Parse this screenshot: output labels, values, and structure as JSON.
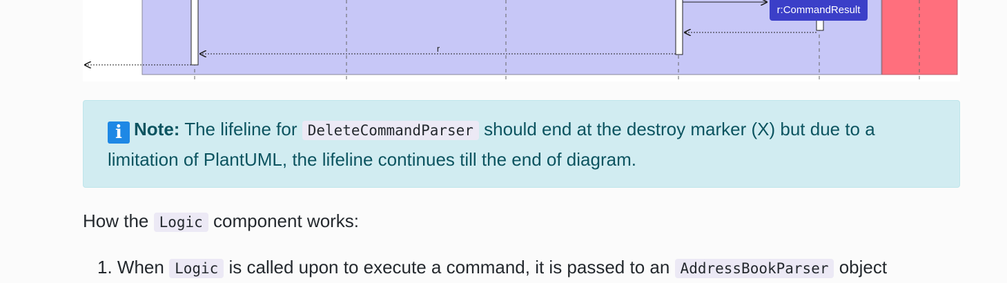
{
  "diagram": {
    "participant_box_label": "r:CommandResult",
    "return_label": "r",
    "colors": {
      "logic_frame": "#c7c7f7",
      "model_frame": "#ff6f7d",
      "participant_box": "#3b3fc8"
    }
  },
  "note": {
    "icon": "info-icon",
    "icon_glyph": "i",
    "label": "Note:",
    "text_before": " The lifeline for ",
    "code": "DeleteCommandParser",
    "text_after": " should end at the destroy marker (X) but due to a limitation of PlantUML, the lifeline continues till the end of diagram."
  },
  "intro": {
    "before": "How the ",
    "code": "Logic",
    "after": " component works:"
  },
  "steps": [
    {
      "number": "1.",
      "before": " When ",
      "code1": "Logic",
      "middle": " is called upon to execute a command, it is passed to an ",
      "code2": "AddressBookParser",
      "after": " object"
    }
  ]
}
